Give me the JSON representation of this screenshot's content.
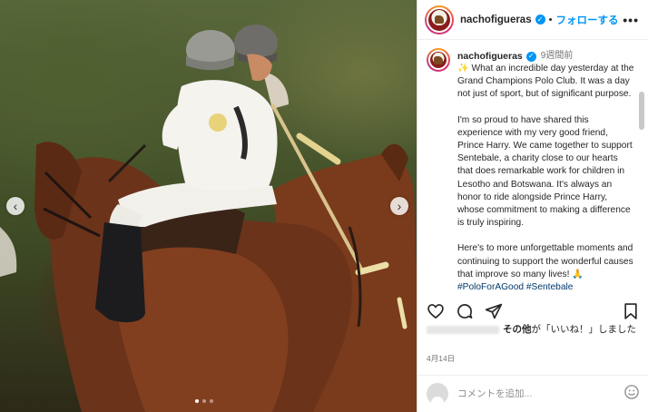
{
  "post": {
    "username": "nachofigueras",
    "follow_label": "フォローする",
    "separator": "•",
    "more_label": "•••"
  },
  "caption": {
    "username": "nachofigueras",
    "time_ago": "9週間前",
    "paragraphs": [
      "✨ What an incredible day yesterday at the Grand Champions Polo Club. It was a day not just of sport, but of significant purpose.",
      "I'm so proud to have shared this experience with my very good friend, Prince Harry. We came together to support Sentebale, a charity close to our hearts that does remarkable work for children in Lesotho and Botswana. It's always an honor to ride alongside Prince Harry, whose commitment to making a difference is truly inspiring.",
      "Here's to more unforgettable moments and continuing to support the wonderful causes that improve so many lives! 🙏"
    ],
    "hashtags": "#PoloForAGood #Sentebale"
  },
  "likes": {
    "text_bold": "その他",
    "text_rest": "が「いいね！」しました"
  },
  "date": "4月14日",
  "comment": {
    "placeholder": "コメントを追加..."
  },
  "carousel": {
    "prev_icon": "chevron-left-icon",
    "next_icon": "chevron-right-icon",
    "slide_count": 3,
    "active_index": 0
  },
  "icons": {
    "like": "heart-icon",
    "comment": "comment-icon",
    "share": "send-icon",
    "save": "bookmark-icon",
    "emoji": "smiley-icon"
  },
  "colors": {
    "accent": "#0095f6",
    "text": "#262626",
    "muted": "#737373"
  }
}
